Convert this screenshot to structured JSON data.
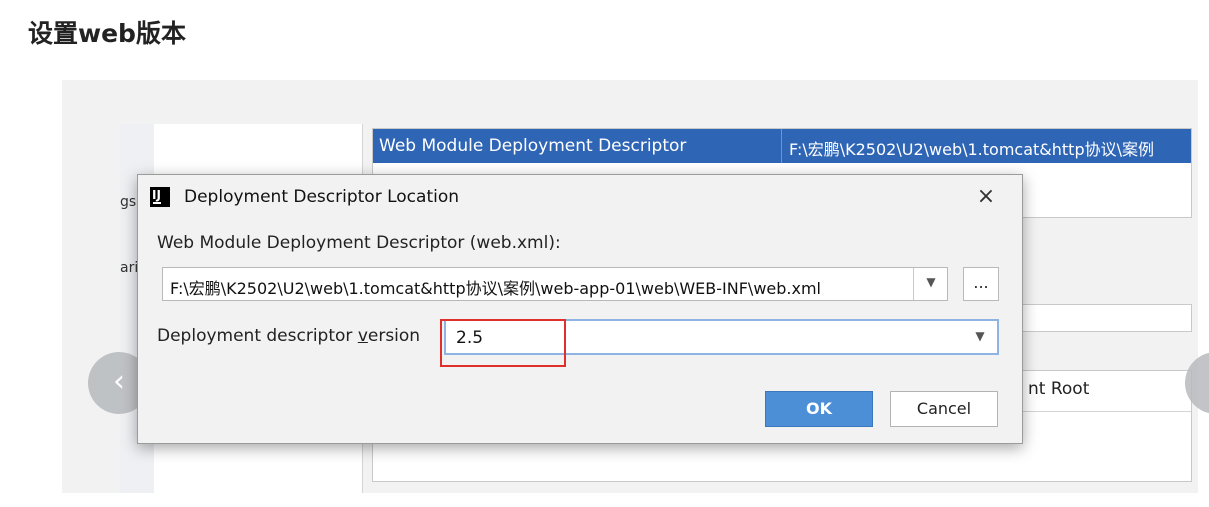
{
  "page_title": "设置web版本",
  "background": {
    "left_fragments": [
      "gs",
      "ari"
    ],
    "table_row": {
      "name": "Web Module Deployment Descriptor",
      "path": "F:\\宏鹏\\K2502\\U2\\web\\1.tomcat&http协议\\案例"
    },
    "web_root_fragment": "nt Root",
    "nav_prev_glyph": "‹"
  },
  "dialog": {
    "icon_text": "IJ",
    "title": "Deployment Descriptor Location",
    "close_glyph": "×",
    "descriptor_label": "Web Module Deployment Descriptor (web.xml):",
    "descriptor_path": "F:\\宏鹏\\K2502\\U2\\web\\1.tomcat&http协议\\案例\\web-app-01\\web\\WEB-INF\\web.xml",
    "combo_arrow": "▼",
    "browse_label": "...",
    "version_label_prefix": "Deployment descriptor ",
    "version_label_mnemonic": "v",
    "version_label_suffix": "ersion",
    "version_value": "2.5",
    "ok_label": "OK",
    "cancel_label": "Cancel"
  },
  "colors": {
    "selection_blue": "#2f65b5",
    "highlight_red": "#e0302c",
    "ok_blue": "#4d8fd6",
    "focus_border": "#8fb3e3"
  }
}
